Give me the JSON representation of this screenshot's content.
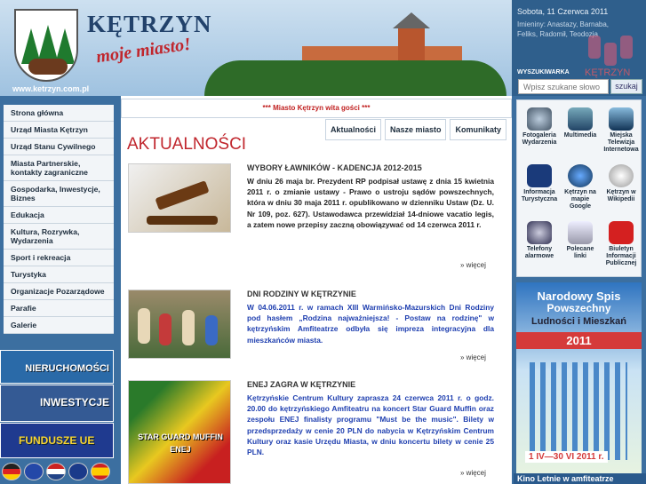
{
  "header": {
    "title": "KĘTRZYN",
    "slogan": "moje miasto!",
    "url": "www.ketrzyn.com.pl",
    "date": "Sobota, 11 Czerwca 2011",
    "namedays": "Imieniny: Anastazy, Barnaba, Feliks, Radomił, Teodozja",
    "brand": "KĘTRZYN"
  },
  "search": {
    "label": "WYSZUKIWARKA",
    "placeholder": "Wpisz szukane słowo",
    "button": "szukaj"
  },
  "nav": [
    "Strona główna",
    "Urząd Miasta Kętrzyn",
    "Urząd Stanu Cywilnego",
    "Miasta Partnerskie, kontakty zagraniczne",
    "Gospodarka, Inwestycje, Biznes",
    "Edukacja",
    "Kultura, Rozrywka, Wydarzenia",
    "Sport i rekreacja",
    "Turystyka",
    "Organizacje Pozarządowe",
    "Parafie",
    "Galerie"
  ],
  "banners": {
    "b1": "NIERUCHOMOŚCI",
    "b2": "INWESTYCJE",
    "b3": "FUNDUSZE UE"
  },
  "welcome": "*** Miasto Kętrzyn wita gości ***",
  "tabs": [
    "Aktualności",
    "Nasze miasto",
    "Komunikaty"
  ],
  "section_title": "AKTUALNOŚCI",
  "news": [
    {
      "title": "WYBORY ŁAWNIKÓW - KADENCJA 2012-2015",
      "text": "W dniu 26 maja br. Prezydent RP podpisał ustawę z dnia 15 kwietnia 2011 r. o zmianie ustawy - Prawo o ustroju sądów powszechnych, która w dniu 30 maja 2011 r. opublikowano w dzienniku Ustaw (Dz. U. Nr 109, poz. 627). Ustawodawca przewidział 14-dniowe vacatio legis, a zatem nowe przepisy zaczną obowiązywać od 14 czerwca 2011 r.",
      "more": "więcej"
    },
    {
      "title": "DNI RODZINY W KĘTRZYNIE",
      "text": "W 04.06.2011 r. w ramach XIII Warmińsko-Mazurskich Dni Rodziny pod hasłem „Rodzina najważniejsza! - Postaw na rodzinę\" w kętrzyńskim Amfiteatrze odbyła się impreza integracyjna dla mieszkańców miasta.",
      "more": "więcej"
    },
    {
      "title": "ENEJ ZAGRA W KĘTRZYNIE",
      "text": "Kętrzyńskie Centrum Kultury zaprasza 24 czerwca 2011 r. o godz. 20.00 do kętrzyńskiego Amfiteatru na koncert Star Guard Muffin oraz zespołu ENEJ finalisty programu \"Must be the music\". Bilety w przedsprzedaży w cenie 20 PLN do nabycia w Kętrzyńskim Centrum Kultury oraz kasie Urzędu Miasta, w dniu koncertu bilety w cenie 25 PLN.",
      "more": "więcej",
      "poster": "STAR GUARD MUFFIN",
      "poster2": "ENEJ"
    }
  ],
  "quicklinks": [
    "Fotogaleria Wydarzenia",
    "Multimedia",
    "Miejska Telewizja Internetowa",
    "Informacja Turystyczna",
    "Kętrzyn na mapie Google",
    "Kętrzyn w Wikipedii",
    "Telefony alarmowe",
    "Polecane linki",
    "Biuletyn Informacji Publicznej"
  ],
  "census": {
    "l1": "Narodowy Spis",
    "l2": "Powszechny",
    "l3": "Ludności i Mieszkań",
    "year": "2011",
    "dates": "1 IV—30 VI 2011 r."
  },
  "kino": "Kino Letnie w amfiteatrze"
}
